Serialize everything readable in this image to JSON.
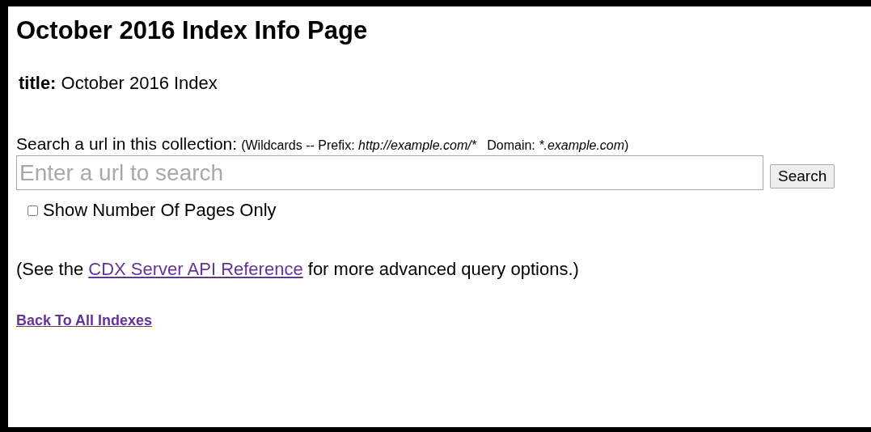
{
  "heading": "October 2016 Index Info Page",
  "title_line": "**title:** October 2016 Index",
  "search": {
    "label": "Search a url in this collection:",
    "hint": [
      {
        "text": "(Wildcards -- Prefix: ",
        "italic": false
      },
      {
        "text": "http://example.com/*",
        "italic": true
      },
      {
        "text": "   Domain: ",
        "italic": false
      },
      {
        "text": "*.example.com",
        "italic": true
      },
      {
        "text": ")",
        "italic": false
      }
    ],
    "placeholder": "Enter a url to search",
    "button": "Search"
  },
  "pages_only": {
    "label": "Show Number Of Pages Only",
    "checked": false
  },
  "api_note": {
    "before": "(See the",
    "link": "CDX Server API Reference",
    "after": "for more advanced query options.)"
  },
  "back_link": "Back To All Indexes"
}
